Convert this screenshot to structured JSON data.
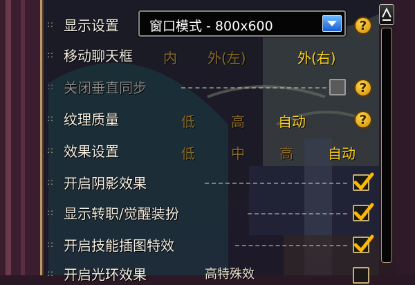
{
  "settings": {
    "display": {
      "label": "显示设置",
      "dropdown_value": "窗口模式 - 800x600",
      "help": "?"
    },
    "chat_frame": {
      "label": "移动聊天框",
      "options": [
        "内",
        "外(左)",
        "外(右)"
      ],
      "selected": "外(右)"
    },
    "vsync": {
      "label": "关闭垂直同步",
      "checked": false,
      "enabled": false,
      "help": "?"
    },
    "texture": {
      "label": "纹理质量",
      "options": [
        "低",
        "高",
        "自动"
      ],
      "selected": "自动",
      "help": "?"
    },
    "effects": {
      "label": "效果设置",
      "options": [
        "低",
        "中",
        "高",
        "自动"
      ],
      "selected": "自动"
    },
    "shadow": {
      "label": "开启阴影效果",
      "checked": true
    },
    "job_costume": {
      "label": "显示转职/觉醒装扮",
      "checked": true
    },
    "skill_cutin": {
      "label": "开启技能插图特效",
      "checked": true
    },
    "halo": {
      "label": "开启光环效果",
      "partial_text": "高特殊效"
    }
  },
  "colors": {
    "selected_option": "#ffd21a",
    "unselected_option": "#8a6a26",
    "check_mark": "#ffb800",
    "label": "#f4f0e6"
  }
}
